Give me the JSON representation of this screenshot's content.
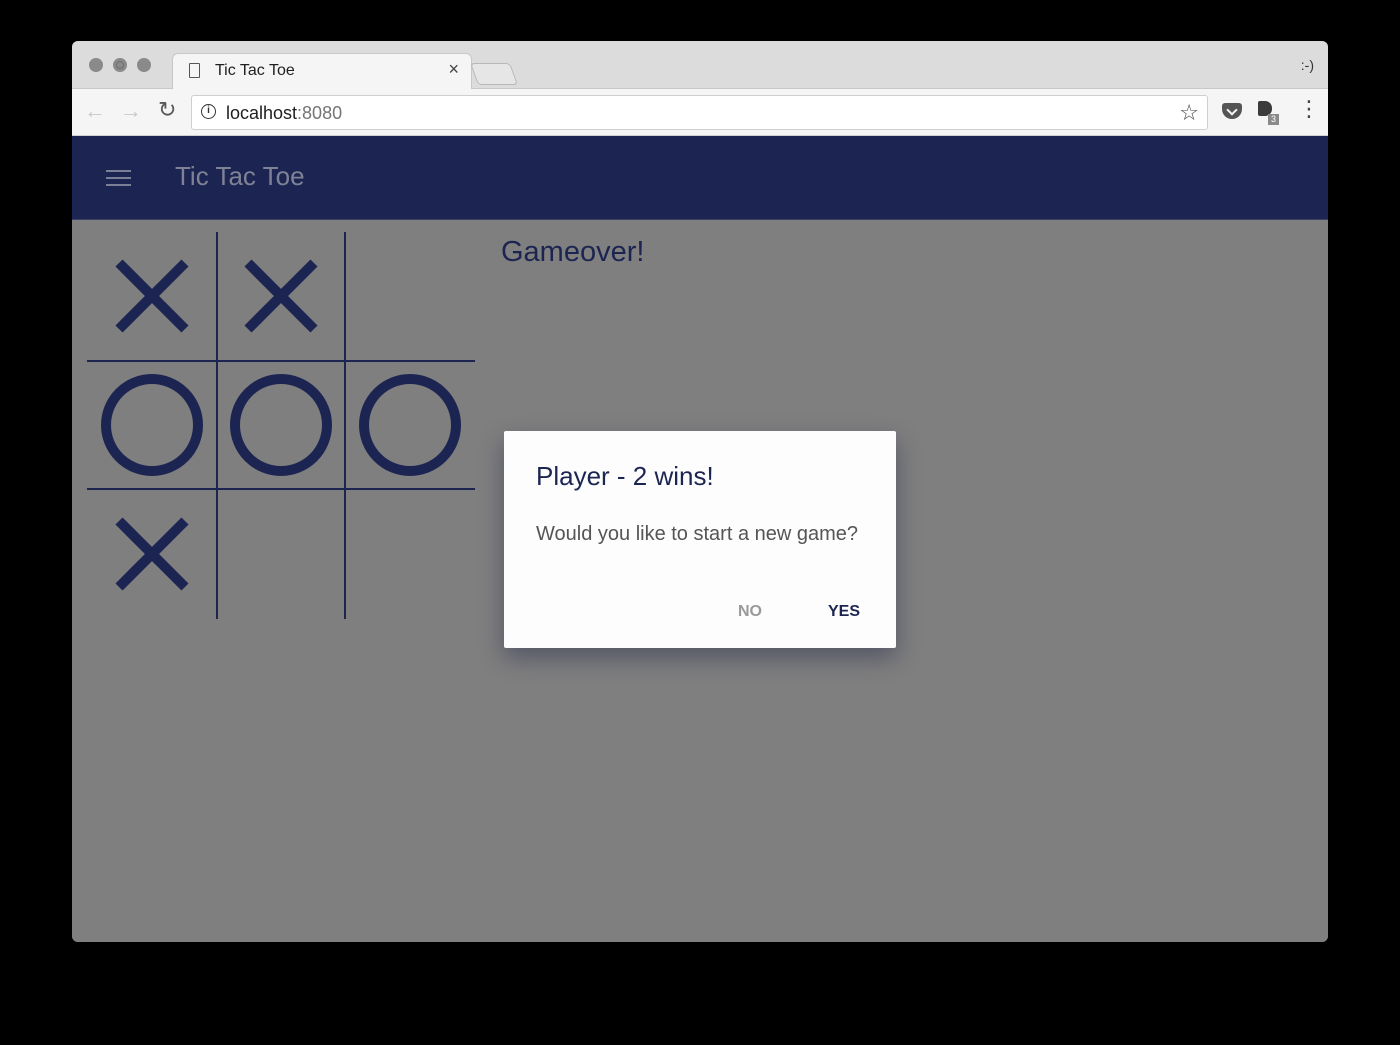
{
  "browser": {
    "tab_title": "Tic Tac Toe",
    "tab_close_glyph": "×",
    "profile_label": ":-)",
    "url_host": "localhost",
    "url_port": ":8080",
    "extension_badge": "3",
    "icons": [
      "page-icon",
      "close-icon",
      "back-arrow-icon",
      "forward-arrow-icon",
      "reload-icon",
      "info-icon",
      "star-icon",
      "pocket-icon",
      "extension-icon",
      "more-vert-icon"
    ]
  },
  "app_bar": {
    "title": "Tic Tac Toe",
    "background": "#1c2551",
    "menu_icon": "menu-icon"
  },
  "board": {
    "cells": [
      "X",
      "X",
      "",
      "O",
      "O",
      "O",
      "X",
      "",
      ""
    ],
    "mark_color": "#1c2551"
  },
  "status": {
    "text": "Gameover!"
  },
  "dialog": {
    "title": "Player - 2 wins!",
    "message": "Would you like to start a new game?",
    "no_label": "NO",
    "yes_label": "YES"
  },
  "colors": {
    "accent": "#1c2551",
    "overlay": "#7f7f7f"
  }
}
